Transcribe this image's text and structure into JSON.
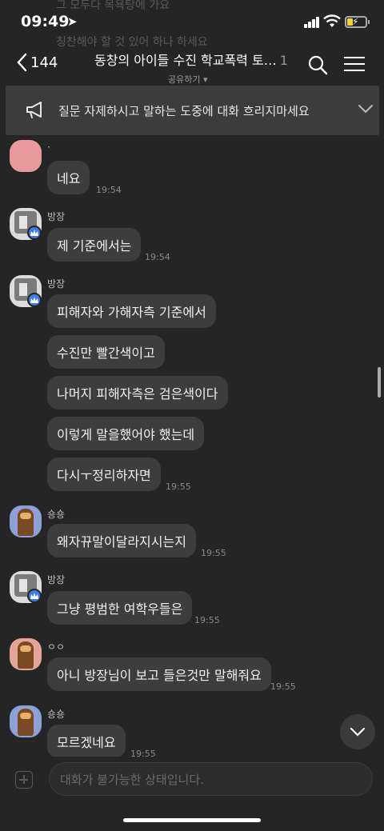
{
  "status": {
    "time": "09:49",
    "ghost_lines": [
      "그 모두다 목욕탕에 가요",
      "칭찬해야 할 것 있어 하나 하세요"
    ]
  },
  "header": {
    "back_count": "144",
    "title": "동창의 아이들 수진 학교폭력 토…",
    "member_count": "1",
    "subtitle": "공유하기 ▾"
  },
  "notice": {
    "text": "질문 자제하시고 말하는 도중에 대화 흐리지마세요"
  },
  "messages": [
    {
      "sender": "·",
      "bubbles": [
        "네요"
      ],
      "time": "19:54"
    },
    {
      "sender": "방장",
      "bubbles": [
        "제 기준에서는"
      ],
      "time": "19:54"
    },
    {
      "sender": "방장",
      "bubbles": [
        "피해자와 가해자측 기준에서",
        "수진만 빨간색이고",
        "나머지 피해자측은 검은색이다",
        "이렇게 말을했어야 했는데",
        "다시ㅜ정리하자면"
      ],
      "time": "19:55"
    },
    {
      "sender": "숑숑",
      "bubbles": [
        "왜자뀨말이달라지시는지"
      ],
      "time": "19:55"
    },
    {
      "sender": "방장",
      "bubbles": [
        "그냥 평범한 여학우들은"
      ],
      "time": "19:55"
    },
    {
      "sender": "ㅇㅇ",
      "bubbles": [
        "아니 방장님이 보고 들은것만 말해줘요"
      ],
      "time": "19:55"
    },
    {
      "sender": "숑숑",
      "bubbles": [
        "모르겠네요"
      ],
      "time": "19:55"
    }
  ],
  "input": {
    "placeholder": "대화가 불가능한 상태입니다."
  }
}
